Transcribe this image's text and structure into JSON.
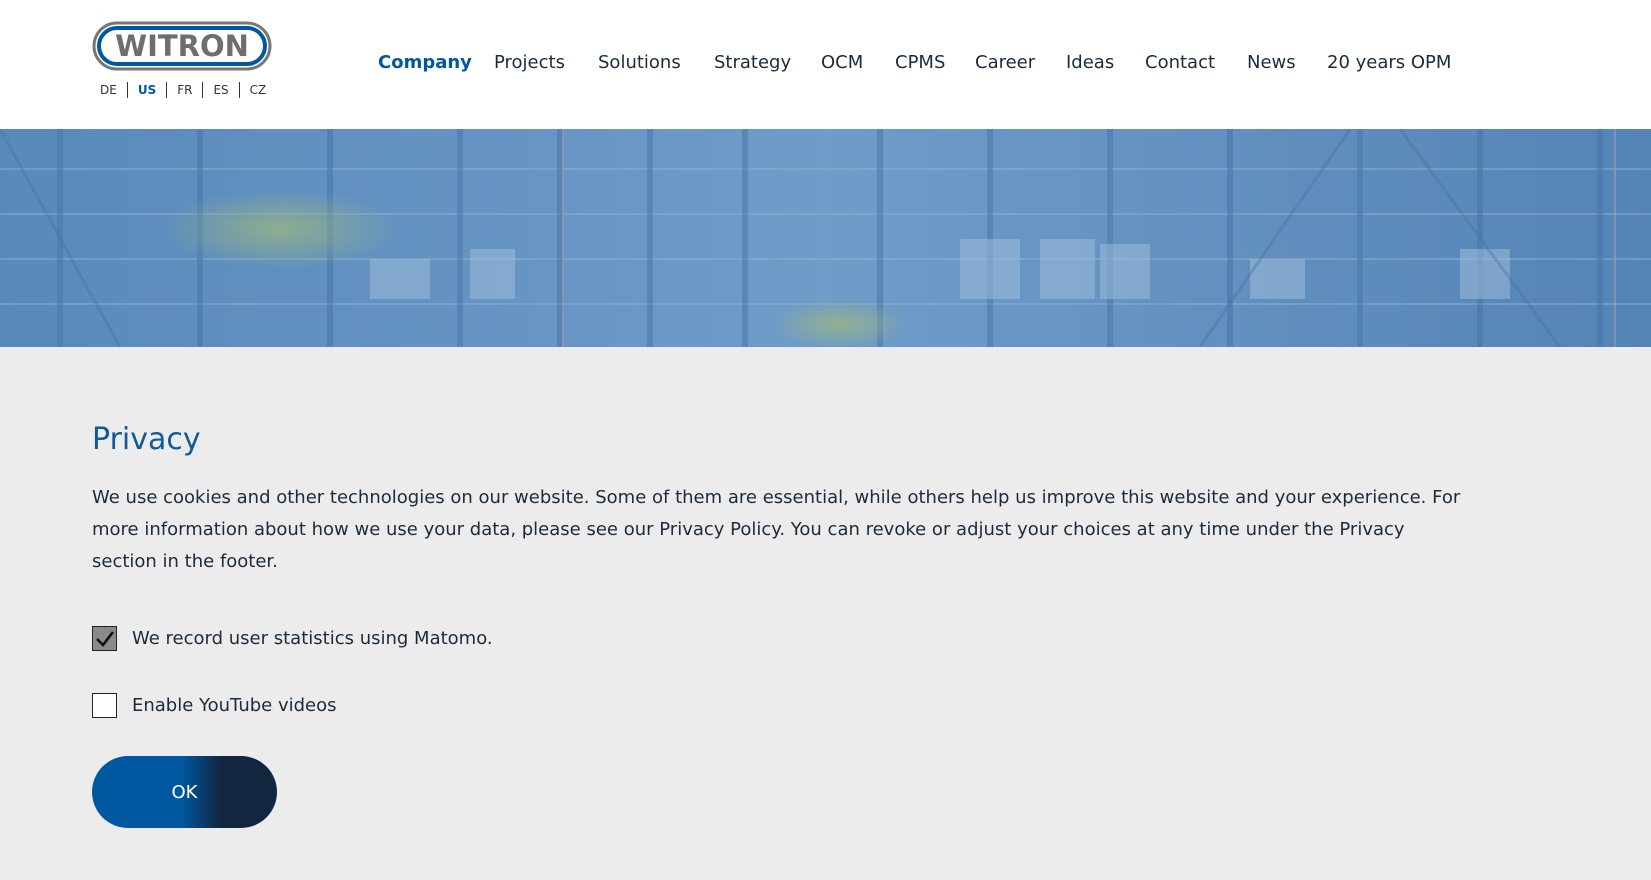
{
  "header": {
    "logo_text": "WITRON",
    "languages": [
      {
        "label": "DE",
        "active": false
      },
      {
        "label": "US",
        "active": true
      },
      {
        "label": "FR",
        "active": false
      },
      {
        "label": "ES",
        "active": false
      },
      {
        "label": "CZ",
        "active": false
      }
    ],
    "nav": [
      {
        "label": "Company",
        "active": true
      },
      {
        "label": "Projects",
        "active": false
      },
      {
        "label": "Solutions",
        "active": false
      },
      {
        "label": "Strategy",
        "active": false
      },
      {
        "label": "OCM",
        "active": false
      },
      {
        "label": "CPMS",
        "active": false
      },
      {
        "label": "Career",
        "active": false
      },
      {
        "label": "Ideas",
        "active": false
      },
      {
        "label": "Contact",
        "active": false
      },
      {
        "label": "News",
        "active": false
      },
      {
        "label": "20 years OPM",
        "active": false
      }
    ]
  },
  "privacy": {
    "title": "Privacy",
    "description": "We use cookies and other technologies on our website. Some of them are essential, while others help us improve this website and your experience. For more information about how we use your data, please see our Privacy Policy. You can revoke or adjust your choices at any time under the Privacy section in the footer.",
    "options": [
      {
        "label": "We record user statistics using Matomo.",
        "checked": true
      },
      {
        "label": "Enable YouTube videos",
        "checked": false
      }
    ],
    "ok_label": "OK"
  },
  "colors": {
    "brand_blue": "#0058a0",
    "dark_navy": "#13263f",
    "background": "#ececec"
  }
}
